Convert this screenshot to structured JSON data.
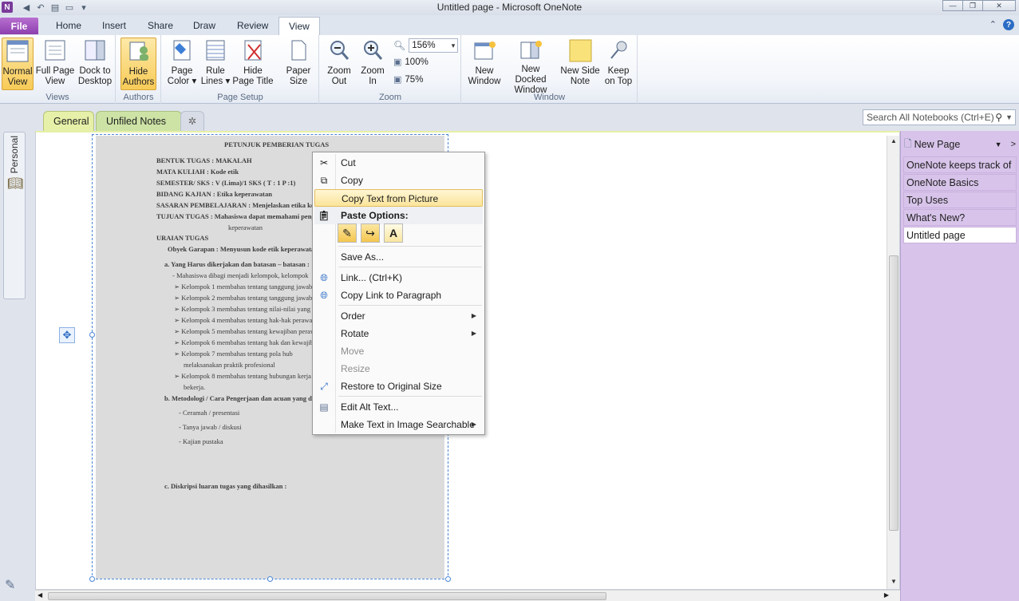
{
  "window": {
    "title": "Untitled page  -  Microsoft OneNote",
    "app_icon": "N",
    "controls": {
      "minimize": "—",
      "restore": "❐",
      "close": "✕"
    }
  },
  "ribbon_tabs": [
    {
      "label": "File"
    },
    {
      "label": "Home"
    },
    {
      "label": "Insert"
    },
    {
      "label": "Share"
    },
    {
      "label": "Draw"
    },
    {
      "label": "Review"
    },
    {
      "label": "View"
    }
  ],
  "ribbon": {
    "groups": {
      "views": "Views",
      "authors": "Authors",
      "page_setup": "Page Setup",
      "zoom": "Zoom",
      "window": "Window"
    },
    "normal_view": [
      "Normal",
      "View"
    ],
    "full_page_view": [
      "Full Page",
      "View"
    ],
    "dock_to_desktop": [
      "Dock to",
      "Desktop"
    ],
    "hide_authors": [
      "Hide",
      "Authors"
    ],
    "page_color": [
      "Page",
      "Color ▾"
    ],
    "rule_lines": [
      "Rule",
      "Lines ▾"
    ],
    "hide_page_title": [
      "Hide",
      "Page Title"
    ],
    "paper_size": [
      "Paper",
      "Size"
    ],
    "zoom_out": [
      "Zoom",
      "Out"
    ],
    "zoom_in": [
      "Zoom",
      "In"
    ],
    "zoom_value": "156%",
    "zoom_100": "100%",
    "zoom_75": "75%",
    "new_window": [
      "New",
      "Window"
    ],
    "new_docked_window": [
      "New Docked",
      "Window"
    ],
    "new_side_note": [
      "New Side",
      "Note"
    ],
    "keep_on_top": [
      "Keep",
      "on Top"
    ]
  },
  "notebook": {
    "name": "Personal",
    "sections": [
      {
        "label": "General",
        "color": "#e6f0a8"
      },
      {
        "label": "Unfiled Notes",
        "color": "#cde3a6"
      }
    ],
    "search_placeholder": "Search All Notebooks (Ctrl+E)"
  },
  "pages_pane": {
    "new_page": "New Page",
    "pages": [
      {
        "label": "OneNote keeps track of"
      },
      {
        "label": "OneNote Basics"
      },
      {
        "label": "Top Uses"
      },
      {
        "label": "What's New?"
      },
      {
        "label": "Untitled page"
      }
    ]
  },
  "document": {
    "lines": [
      "PETUNJUK PEMBERIAN TUGAS",
      "BENTUK TUGAS   : MAKALAH",
      "MATA KULIAH    : Kode etik",
      "SEMESTER/ SKS   : V (Lima)/1 SKS  ( T : 1    P :1)",
      "BIDANG KAJIAN  : Etika keperawatan",
      "SASARAN  PEMBELAJARAN : Menjelaskan etika keper",
      "TUJUAN TUGAS   : Mahasiswa dapat memahami pengert",
      "keperawatan",
      "URAIAN TUGAS",
      "Obyek Garapan  : Menyusun  kode etik keperawatan",
      "a.  Yang Harus dikerjakan dan batasan – batasan :",
      "- Mahasiswa dibagi menjadi  kelompok, kelompok",
      "➢  Kelompok 1 membahas tentang tanggung jawab p",
      "➢  Kelompok 2 membahas tentang  tanggung jawab p",
      "➢  Kelompok 3 membahas tentang  nilai-nilai yang d",
      "➢  Kelompok 4 membahas tentang  hak-hak perawat",
      "➢  Kelompok 5 membahas tentang  kewajiban peraw",
      "➢  Kelompok 6 membahas tentang hak dan kewajiba",
      "➢  Kelompok  7   membahas   tentang     pola   hub",
      "melaksanakan praktik profesional",
      "➢  Kelompok 8 membahas tentang hubungan kerja p",
      "bekerja.",
      "b.  Metodologi / Cara Pengerjaan dan acuan yang dig",
      "-   Ceramah / presentasi",
      "-   Tanya jawab / diskusi",
      "-   Kajian pustaka",
      "c.  Diskripsi luaran tugas yang dihasilkan :"
    ]
  },
  "context_menu": {
    "cut": "Cut",
    "copy": "Copy",
    "copy_text_from_picture": "Copy Text from Picture",
    "paste_options": "Paste Options:",
    "save_as": "Save As...",
    "link": "Link...  (Ctrl+K)",
    "copy_link_to_paragraph": "Copy Link to Paragraph",
    "order": "Order",
    "rotate": "Rotate",
    "move": "Move",
    "resize": "Resize",
    "restore_to_original_size": "Restore to Original Size",
    "edit_alt_text": "Edit Alt Text...",
    "make_text_searchable": "Make Text in Image Searchable"
  },
  "colors": {
    "file_tab": "#8c3fae",
    "pages_pane": "#d8c4ea",
    "highlight": "#fbe49a",
    "selection_border": "#4a86d8"
  }
}
